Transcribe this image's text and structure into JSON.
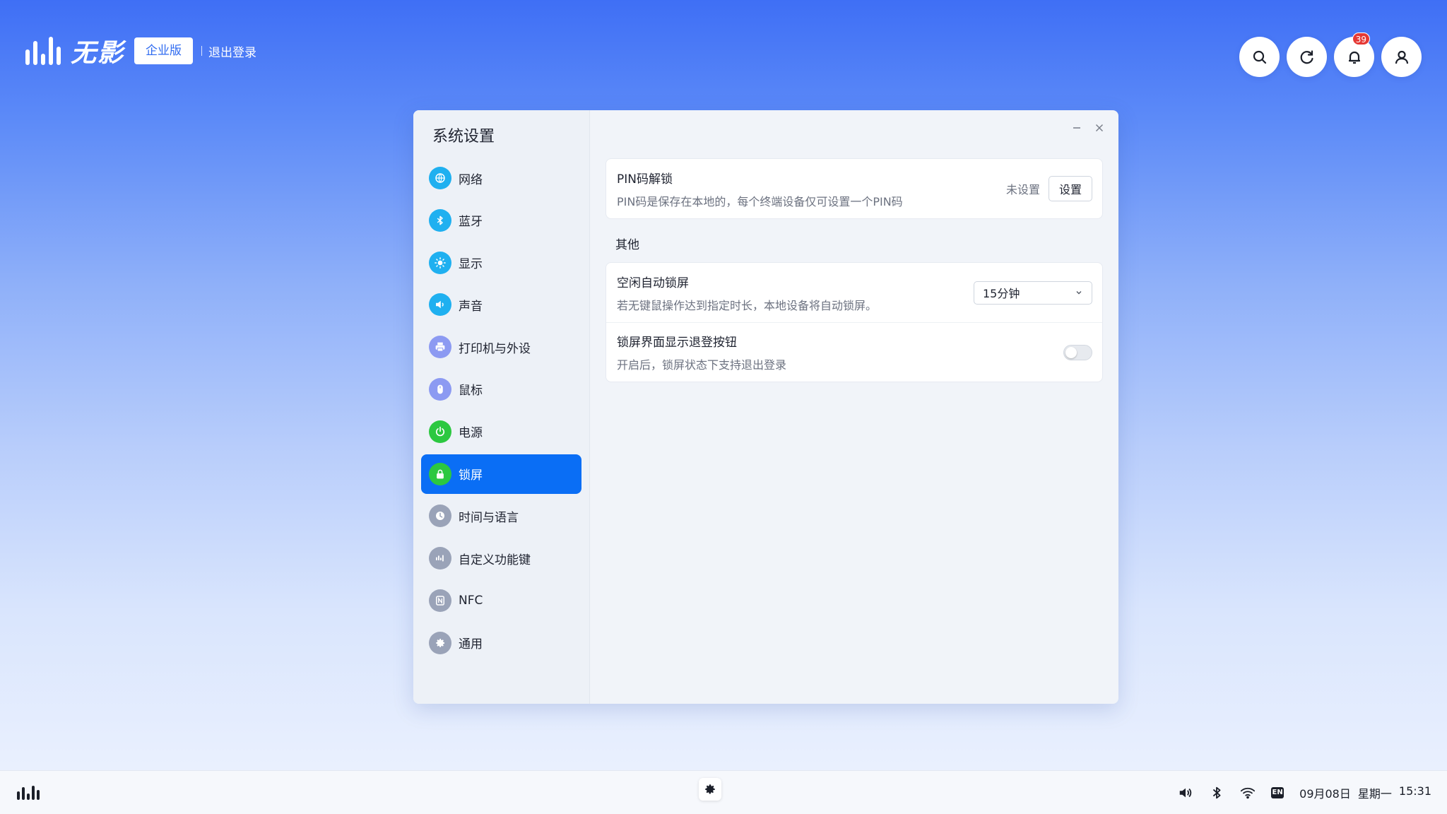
{
  "header": {
    "brand_name": "无影",
    "edition": "企业版",
    "logout": "退出登录",
    "notification_count": "39",
    "actions": [
      "search-icon",
      "refresh-icon",
      "bell-icon",
      "user-icon"
    ]
  },
  "window": {
    "title": "系统设置",
    "sidebar": {
      "items": [
        {
          "label": "网络",
          "icon": "globe-icon",
          "color": "#1fb0f0"
        },
        {
          "label": "蓝牙",
          "icon": "bluetooth-icon",
          "color": "#1fb0f0"
        },
        {
          "label": "显示",
          "icon": "sun-icon",
          "color": "#1fb0f0"
        },
        {
          "label": "声音",
          "icon": "speaker-icon",
          "color": "#1fb0f0"
        },
        {
          "label": "打印机与外设",
          "icon": "printer-icon",
          "color": "#8c9af2"
        },
        {
          "label": "鼠标",
          "icon": "mouse-icon",
          "color": "#8c9af2"
        },
        {
          "label": "电源",
          "icon": "power-icon",
          "color": "#2cc840"
        },
        {
          "label": "锁屏",
          "icon": "lock-icon",
          "color": "#2cc840",
          "active": true
        },
        {
          "label": "时间与语言",
          "icon": "clock-icon",
          "color": "#9aa3b8"
        },
        {
          "label": "自定义功能键",
          "icon": "keys-icon",
          "color": "#9aa3b8"
        },
        {
          "label": "NFC",
          "icon": "nfc-icon",
          "color": "#9aa3b8"
        },
        {
          "label": "通用",
          "icon": "gear-icon",
          "color": "#9aa3b8"
        }
      ]
    },
    "pin": {
      "title": "PIN码解锁",
      "desc": "PIN码是保存在本地的，每个终端设备仅可设置一个PIN码",
      "status": "未设置",
      "button": "设置"
    },
    "other": {
      "label": "其他",
      "idle_lock": {
        "title": "空闲自动锁屏",
        "desc": "若无键鼠操作达到指定时长，本地设备将自动锁屏。",
        "selected": "15分钟"
      },
      "show_logout": {
        "title": "锁屏界面显示退登按钮",
        "desc": "开启后，锁屏状态下支持退出登录",
        "enabled": false
      }
    }
  },
  "taskbar": {
    "lang": "EN",
    "date": "09月08日",
    "weekday": "星期一",
    "time": "15:31"
  }
}
